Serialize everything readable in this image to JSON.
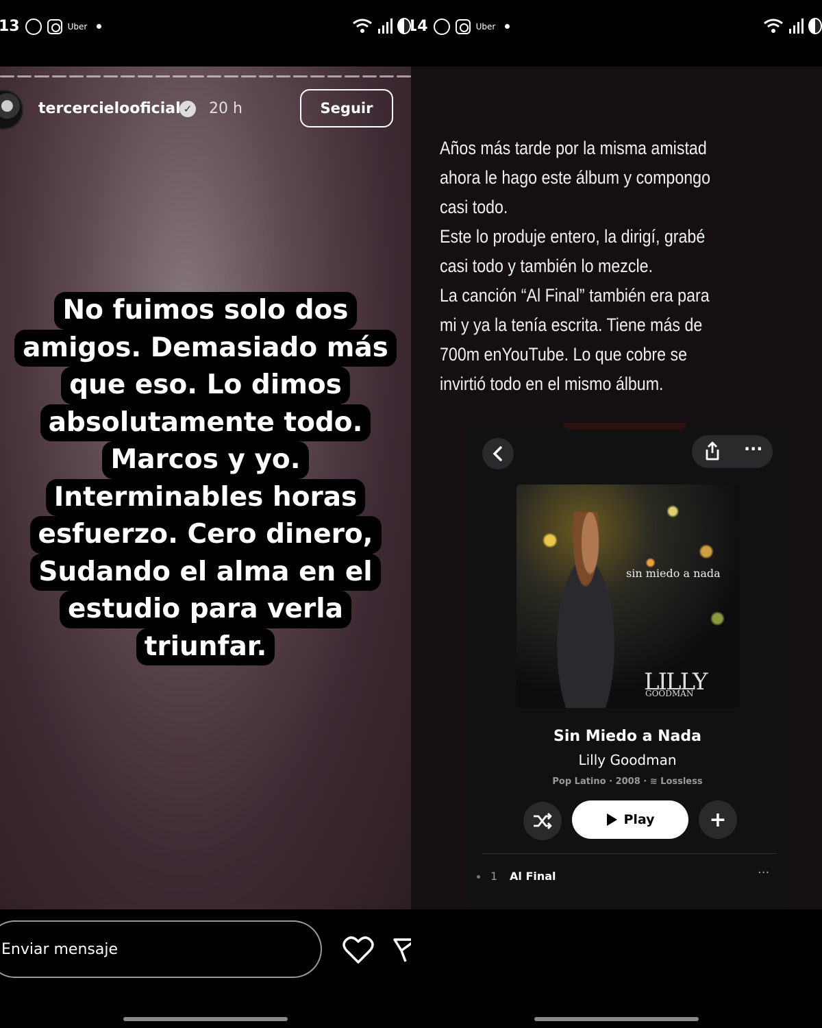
{
  "status_left": {
    "time": "13",
    "uber": "Uber"
  },
  "status_right": {
    "time": "14",
    "uber": "Uber"
  },
  "story": {
    "username": "tercercielooficial",
    "time_ago": "20 h",
    "follow_label": "Seguir",
    "lines": [
      "No fuimos solo dos",
      "amigos. Demasiado más",
      "que eso. Lo dimos",
      "absolutamente todo.",
      "Marcos y yo.",
      "Interminables horas",
      "esfuerzo. Cero dinero,",
      "Sudando el alma en el",
      "estudio para verla",
      "triunfar."
    ],
    "message_placeholder": "Enviar mensaje"
  },
  "right": {
    "text": "Años más tarde por la misma amistad\nahora le hago este álbum y compongo\ncasi todo.\nEste lo produje entero, la dirigí, grabé\ncasi todo y también lo mezcle.\nLa canción “Al Final” también era para\nmi y ya la tenía escrita. Tiene más de\n700m enYouTube. Lo que cobre se\ninvirtió todo en el mismo álbum.",
    "album": {
      "art_title": "sin miedo a nada",
      "art_logo": "LILLY",
      "art_logo_sub": "GOODMAN",
      "title": "Sin Miedo a Nada",
      "artist": "Lilly Goodman",
      "meta": "Pop Latino · 2008 · ≋ Lossless",
      "play_label": "Play",
      "tracks": [
        {
          "number": "1",
          "name": "Al Final"
        }
      ]
    }
  }
}
